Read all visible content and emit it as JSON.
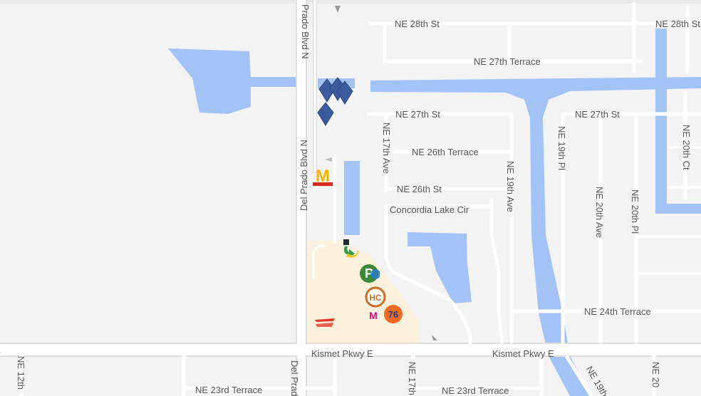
{
  "map": {
    "colors": {
      "land": "#f3f3f3",
      "road": "#ffffff",
      "road_outline": "#dedede",
      "water": "#a3c2f5",
      "commercial": "#fbf1dc",
      "pin": "#3b5b9c"
    },
    "streets": {
      "ne_28th_st_1": "NE 28th St",
      "ne_28th_st_2": "NE 28th St",
      "ne_27th_terrace": "NE 27th Terrace",
      "ne_27th_st_1": "NE 27th St",
      "ne_27th_st_2": "NE 27th St",
      "ne_26th_terrace": "NE 26th Terrace",
      "ne_26th_st": "NE 26th St",
      "concordia_lake_cir": "Concordia Lake Cir",
      "ne_24th_terrace": "NE 24th Terrace",
      "kismet_pkwy_e_1": "Kismet Pkwy E",
      "kismet_pkwy_e_2": "Kismet Pkwy E",
      "kismet_pkwy_e_edge": "y E",
      "ne_23rd_terrace_1": "NE 23rd Terrace",
      "ne_23rd_terrace_2": "NE 23rd Terrace",
      "del_prado_1": "Prado Blvd N",
      "del_prado_2": "Del Prado Blvd N",
      "del_prado_3": "Del Prado",
      "ne_17th_ave": "NE 17th Ave",
      "ne_17th_bottom": "NE 17th",
      "ne_19th_ave": "NE 19th Ave",
      "ne_19th_pl": "NE 19th Pl",
      "ne_19th_bottom": "NE 19th",
      "ne_20th_ave": "NE 20th Ave",
      "ne_20th_pl": "NE 20th Pl",
      "ne_20th_ct": "NE 20th Ct",
      "ne_20_bottom": "NE 20",
      "ne_12th": "NE 12th"
    },
    "pois": {
      "mcdonalds": "M",
      "gas_76": "76",
      "autozone": "AutoZone",
      "metro_by_tmobile": "M",
      "hc": "HC",
      "publix": "P"
    },
    "pins": [
      "property-pin",
      "property-pin",
      "property-pin",
      "property-pin"
    ]
  }
}
